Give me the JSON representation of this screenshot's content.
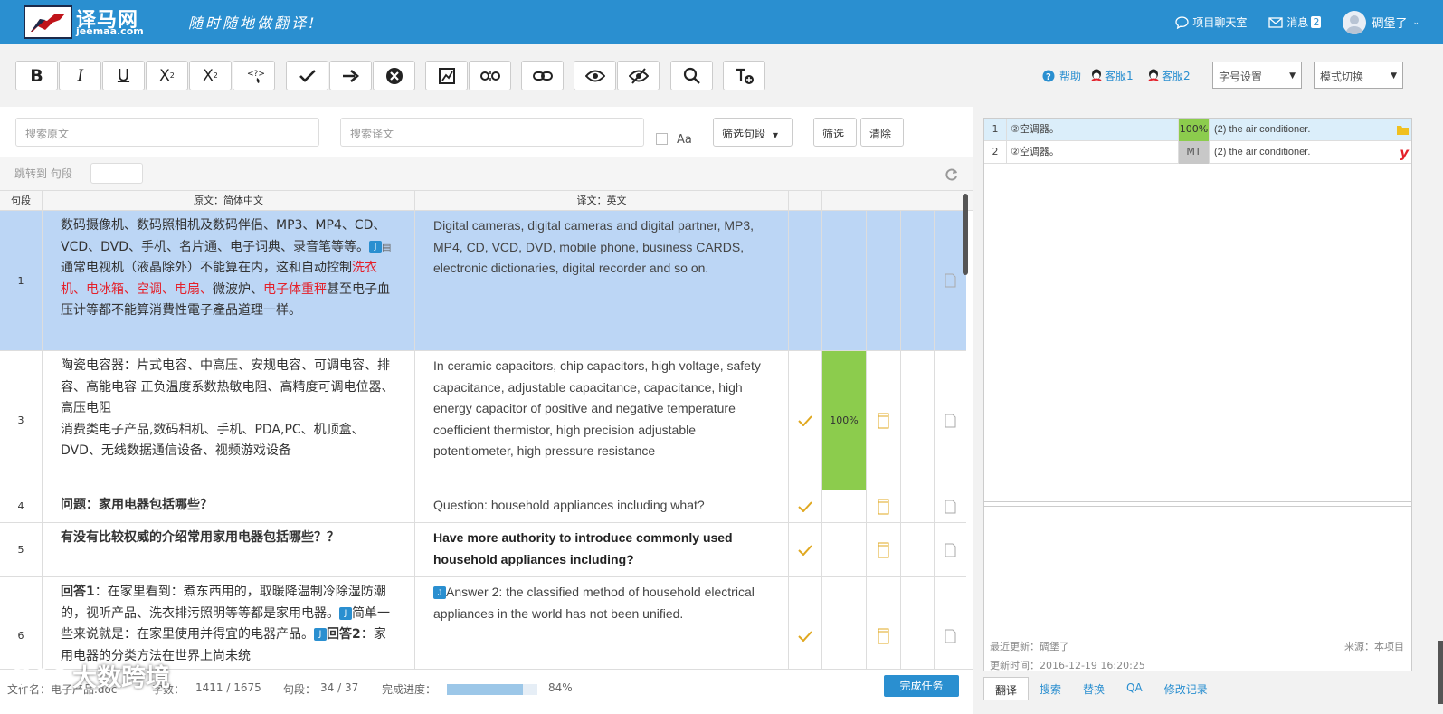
{
  "brand": {
    "name": "译马网",
    "domain": "jeemaa.com",
    "slogan": "随时随地做翻译!"
  },
  "topnav": {
    "chat": "项目聊天室",
    "messages": "消息",
    "msg_count": "2",
    "user": "碉堡了"
  },
  "toolbar": {
    "help": "帮助",
    "cs1": "客服1",
    "cs2": "客服2",
    "font_setting": "字号设置",
    "mode_switch": "模式切换",
    "bold": "B",
    "italic": "I",
    "underline": "U",
    "subscript": "X",
    "superscript": "X"
  },
  "search": {
    "source_placeholder": "搜索原文",
    "target_placeholder": "搜索译文",
    "case_label": "Aa",
    "filter_segments": "筛选句段",
    "filter": "筛选",
    "clear": "清除",
    "jump_label": "跳转到 句段"
  },
  "table": {
    "headers": [
      "句段",
      "原文：简体中文",
      "译文：英文"
    ],
    "rows": [
      {
        "num": "1"
      },
      {
        "num": "3",
        "match": "100%",
        "source": "陶瓷电容器：片式电容、中高压、安规电容、可调电容、排容、高能电容 正负温度系数热敏电阻、高精度可调电位器、高压电阻\n消费类电子产品,数码相机、手机、PDA,PC、机顶盒、DVD、无线数据通信设备、视频游戏设备",
        "target": "In ceramic capacitors, chip capacitors, high voltage, safety capacitance, adjustable capacitance, capacitance, high energy capacitor of positive and negative temperature coefficient thermistor, high precision adjustable potentiometer, high pressure resistance"
      },
      {
        "num": "4",
        "source": "问题：家用电器包括哪些？",
        "target": "Question: household appliances including what?"
      },
      {
        "num": "5",
        "source": "有没有比较权威的介绍常用家用电器包括哪些？？",
        "target": "Have more authority to introduce commonly used household appliances including?"
      },
      {
        "num": "6"
      }
    ],
    "row1": {
      "s1": "数码摄像机、数码照相机及数码伴侣、MP3、MP4、CD、VCD、DVD、手机、名片通、电子词典、录音笔等等。",
      "tag": "J",
      "s2": "通常电视机（液晶除外）不能算在内，这和自动控制",
      "s3": "洗衣机、电冰箱、空调、电扇、",
      "s4": "微波炉、",
      "s5": "电子体重秤",
      "s6": "甚至电子血压计等都不能算消費性電子產品道理一样。",
      "target": "Digital cameras, digital cameras and digital partner, MP3, MP4, CD, VCD, DVD, mobile phone, business CARDS, electronic dictionaries, digital recorder and so on."
    },
    "row6": {
      "b1": "回答1",
      "s1": "：在家里看到：煮东西用的，取暖降温制冷除湿防潮的，视听产品、洗衣排污照明等等都是家用电器。",
      "tag": "J",
      "s2": "简单一些来说就是：在家里使用并得宜的电器产品。",
      "b2": "回答2",
      "s3": "：家用电器的分类方法在世界上尚未统",
      "target": "Answer 2: the classified method of household electrical appliances in the world has not been unified."
    }
  },
  "status": {
    "file": "文件名：电子产品.doc",
    "words_label": "字数：",
    "words": "1411 / 1675",
    "segments_label": "句段：",
    "segments": "34 / 37",
    "progress_label": "完成进度：",
    "progress": "84%",
    "progress_value": 0.84,
    "complete_button": "完成任务"
  },
  "tm": {
    "rows": [
      {
        "num": "1",
        "source": "②空调器。",
        "match": "100%",
        "target": "(2) the air conditioner."
      },
      {
        "num": "2",
        "source": "②空调器。",
        "match": "MT",
        "target": "(2) the air conditioner."
      }
    ],
    "last_update_label": "最近更新：碉堡了",
    "source_label": "来源：本项目",
    "update_time": "更新时间：2016-12-19 16:20:25"
  },
  "tabs": [
    "翻译",
    "搜索",
    "替换",
    "QA",
    "修改记录"
  ],
  "watermark": "大数跨境",
  "colors": {
    "accent": "#2a8fd0",
    "selected_row": "#bcd6f5",
    "match_green": "#8ccc4d",
    "red_term": "#e4202a"
  }
}
